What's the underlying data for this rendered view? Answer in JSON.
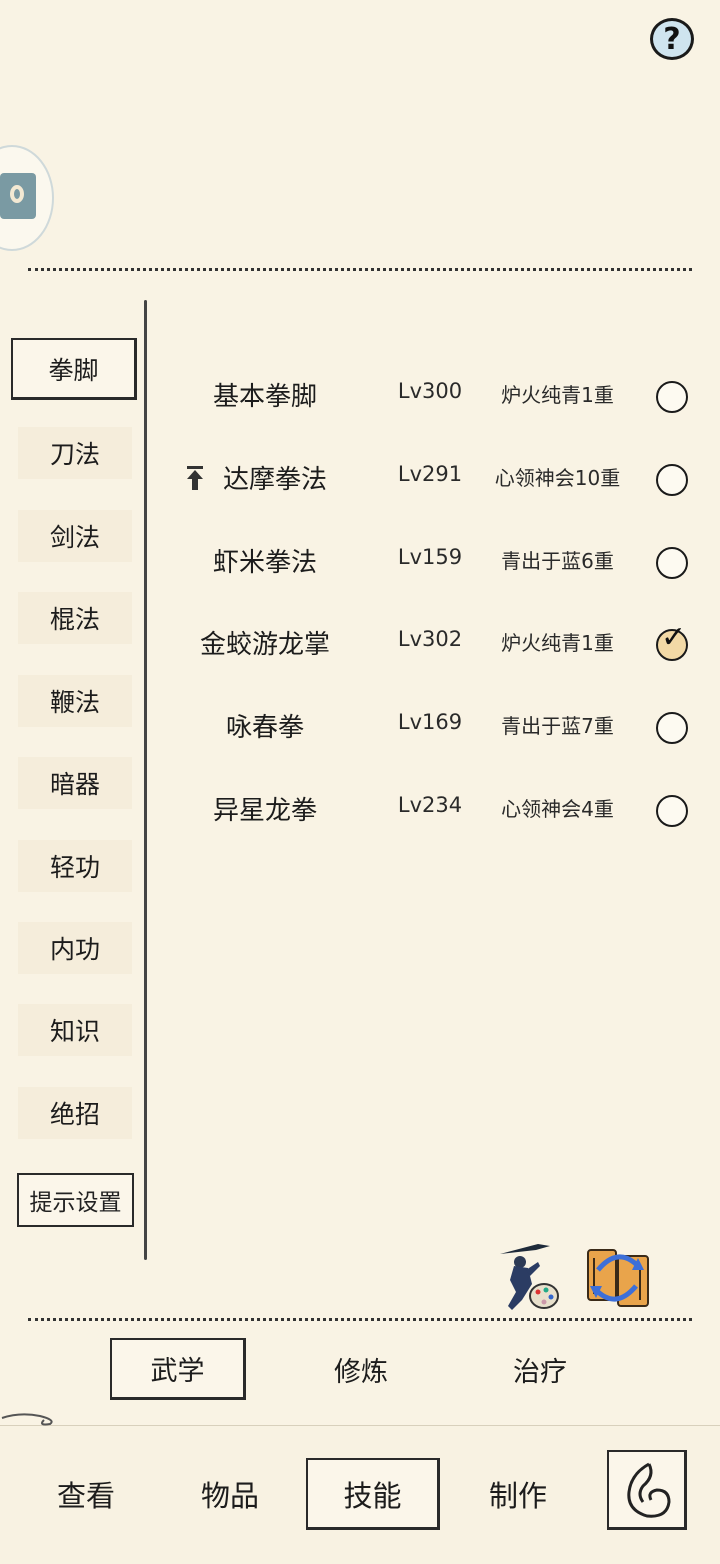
{
  "header": {
    "help_icon": "question-mark-icon",
    "help_label": "?"
  },
  "side_badge": {
    "icon": "character-portrait-icon"
  },
  "categories": [
    {
      "label": "拳脚"
    },
    {
      "label": "刀法"
    },
    {
      "label": "剑法"
    },
    {
      "label": "棍法"
    },
    {
      "label": "鞭法"
    },
    {
      "label": "暗器"
    },
    {
      "label": "轻功"
    },
    {
      "label": "内功"
    },
    {
      "label": "知识"
    },
    {
      "label": "绝招"
    }
  ],
  "hint_settings_label": "提示设置",
  "skills": [
    {
      "name": "基本拳脚",
      "level": "Lv300",
      "realm": "炉火纯青1重",
      "checked": false,
      "upgrade": false
    },
    {
      "name": "达摩拳法",
      "level": "Lv291",
      "realm": "心领神会10重",
      "checked": false,
      "upgrade": true
    },
    {
      "name": "虾米拳法",
      "level": "Lv159",
      "realm": "青出于蓝6重",
      "checked": false,
      "upgrade": false
    },
    {
      "name": "金蛟游龙掌",
      "level": "Lv302",
      "realm": "炉火纯青1重",
      "checked": true,
      "upgrade": false
    },
    {
      "name": "咏春拳",
      "level": "Lv169",
      "realm": "青出于蓝7重",
      "checked": false,
      "upgrade": false
    },
    {
      "name": "异星龙拳",
      "level": "Lv234",
      "realm": "心领神会4重",
      "checked": false,
      "upgrade": false
    }
  ],
  "tools": [
    {
      "icon": "swordsman-palette-icon"
    },
    {
      "icon": "swap-scroll-icon"
    }
  ],
  "subtabs": [
    {
      "label": "武学",
      "active": true
    },
    {
      "label": "修炼",
      "active": false
    },
    {
      "label": "治疗",
      "active": false
    }
  ],
  "nav": [
    {
      "label": "查看",
      "active": false
    },
    {
      "label": "物品",
      "active": false
    },
    {
      "label": "技能",
      "active": true
    },
    {
      "label": "制作",
      "active": false
    }
  ],
  "back_icon": "back-swirl-icon",
  "check_mark": "✓"
}
